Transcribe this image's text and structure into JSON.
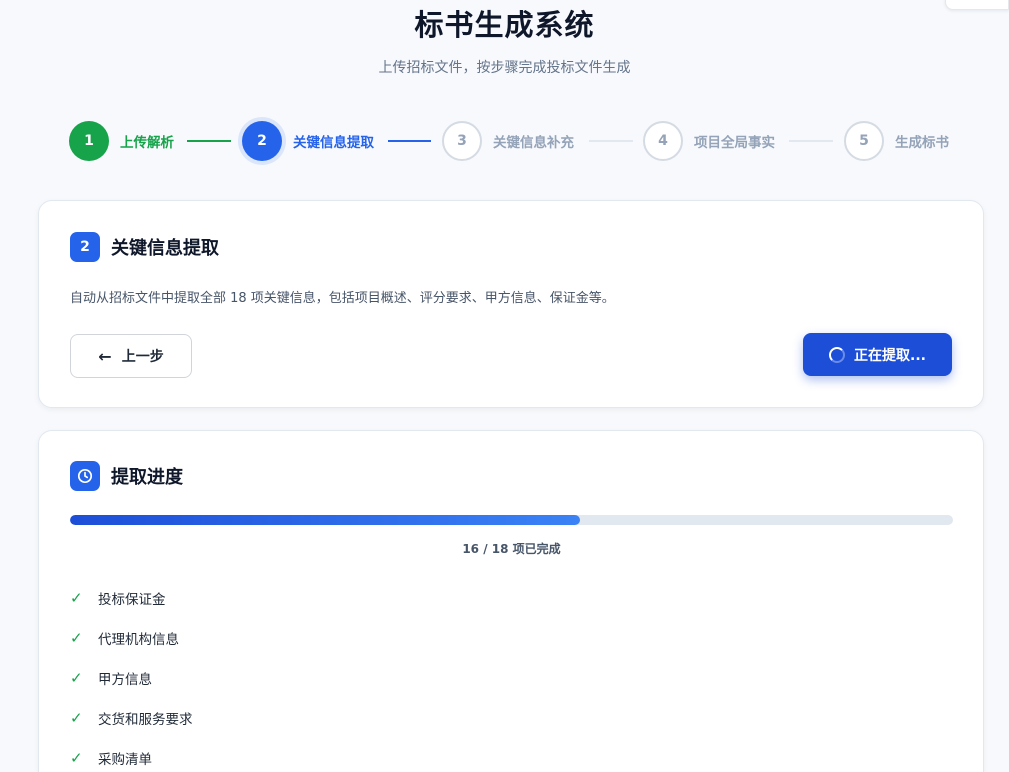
{
  "header": {
    "title": "标书生成系统",
    "subtitle": "上传招标文件，按步骤完成投标文件生成"
  },
  "steps": [
    {
      "num": "1",
      "label": "上传解析",
      "state": "done"
    },
    {
      "num": "2",
      "label": "关键信息提取",
      "state": "active"
    },
    {
      "num": "3",
      "label": "关键信息补充",
      "state": "todo"
    },
    {
      "num": "4",
      "label": "项目全局事实",
      "state": "todo"
    },
    {
      "num": "5",
      "label": "生成标书",
      "state": "todo"
    }
  ],
  "extract_card": {
    "badge": "2",
    "title": "关键信息提取",
    "description": "自动从招标文件中提取全部 18 项关键信息，包括项目概述、评分要求、甲方信息、保证金等。",
    "prev_button": "上一步",
    "extract_button": "正在提取..."
  },
  "progress_card": {
    "icon": "clock-icon",
    "title": "提取进度",
    "completed": 16,
    "total": 18,
    "progress_text": "16 / 18 项已完成",
    "items": [
      "投标保证金",
      "代理机构信息",
      "甲方信息",
      "交货和服务要求",
      "采购清单"
    ]
  },
  "colors": {
    "primary": "#2563eb",
    "success": "#16a34a",
    "muted": "#94a3b8"
  }
}
